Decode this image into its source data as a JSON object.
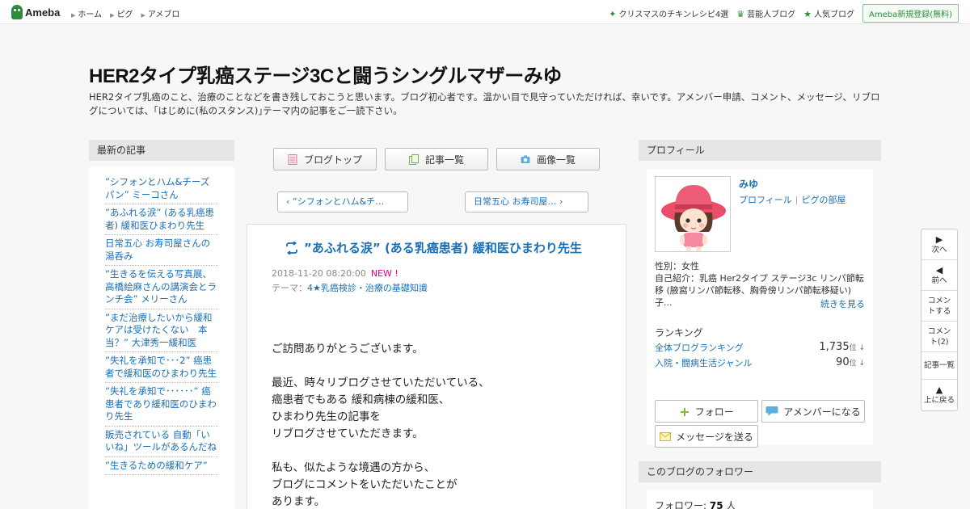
{
  "topbar": {
    "logo": "Ameba",
    "nav": [
      "ホーム",
      "ピグ",
      "アメブロ"
    ],
    "links": [
      "クリスマスのチキンレシピ4選",
      "芸能人ブログ",
      "人気ブログ"
    ],
    "signup": "Ameba新規登録(無料)"
  },
  "header": {
    "title": "HER2タイプ乳癌ステージ3Cと闘うシングルマザーみゆ",
    "description": "HER2タイプ乳癌のこと、治療のことなどを書き残しておこうと思います。ブログ初心者です。温かい目で見守っていただければ、幸いです。アメンバー申請、コメント、メッセージ、リブログについては、｢はじめに(私のスタンス)｣テーマ内の記事をご一読下さい。"
  },
  "left": {
    "heading": "最新の記事",
    "items": [
      "”シフォンとハム&チーズパン” ミーコさん",
      "”あふれる涙” (ある乳癌患者) 緩和医ひまわり先生",
      "日常五心 お寿司屋さんの湯呑み",
      "”生きるを伝える写真展、高橋絵麻さんの講演会とランチ会” メリーさん",
      "”まだ治療したいから緩和ケアは受けたくない　本当？” 大津秀一緩和医",
      "”失礼を承知で･･･2” 癌患者で緩和医のひまわり先生",
      "”失礼を承知で･･････” 癌患者であり緩和医のひまわり先生",
      "販売されている 自動「いいね」ツールがあるんだね",
      "”生きるための緩和ケア”"
    ]
  },
  "toolbar": {
    "blog_top": "ブログトップ",
    "articles": "記事一覧",
    "images": "画像一覧"
  },
  "pager": {
    "prev": "”シフォンとハム&チ…",
    "next": "日常五心 お寿司屋…"
  },
  "article": {
    "title": "”あふれる涙” (ある乳癌患者) 緩和医ひまわり先生",
    "date": "2018-11-20 08:20:00",
    "new_badge": "NEW !",
    "theme_label": "テーマ：",
    "theme": "4★乳癌検診・治療の基礎知識",
    "paragraphs": [
      [
        "ご訪問ありがとうございます。"
      ],
      [
        "最近、時々リブログさせていただいている、",
        "癌患者でもある 緩和病棟の緩和医、",
        "ひまわり先生の記事を",
        "リブログさせていただきます。"
      ],
      [
        "私も、似たような境遇の方から、",
        "ブログにコメントをいただいたことが",
        "あります。"
      ]
    ]
  },
  "profile": {
    "heading": "プロフィール",
    "name": "みゆ",
    "link_profile": "プロフィール",
    "link_room": "ピグの部屋",
    "gender": "性別：女性",
    "intro": "自己紹介：乳癌 Her2タイプ ステージ3c リンパ節転移 (腋窩リンパ節転移、胸骨傍リンパ節転移疑い) 子...",
    "more": "続きを見る",
    "ranking_heading": "ランキング",
    "rankings": [
      {
        "label": "全体ブログランキング",
        "value": "1,735",
        "unit": "位 ↓"
      },
      {
        "label": "入院・闘病生活ジャンル",
        "value": "90",
        "unit": "位 ↓"
      }
    ],
    "follow": "フォロー",
    "amember": "アメンバーになる",
    "message": "メッセージを送る"
  },
  "followers": {
    "heading": "このブログのフォロワー",
    "label": "フォロワー: ",
    "count": "75",
    "unit": " 人"
  },
  "floatnav": [
    "次へ",
    "前へ",
    "コメントする",
    "コメント(2)",
    "記事一覧",
    "上に戻る"
  ],
  "colors": {
    "link": "#1a6fb5",
    "accent_green": "#2d8c3c",
    "new_badge": "#e4007f"
  }
}
